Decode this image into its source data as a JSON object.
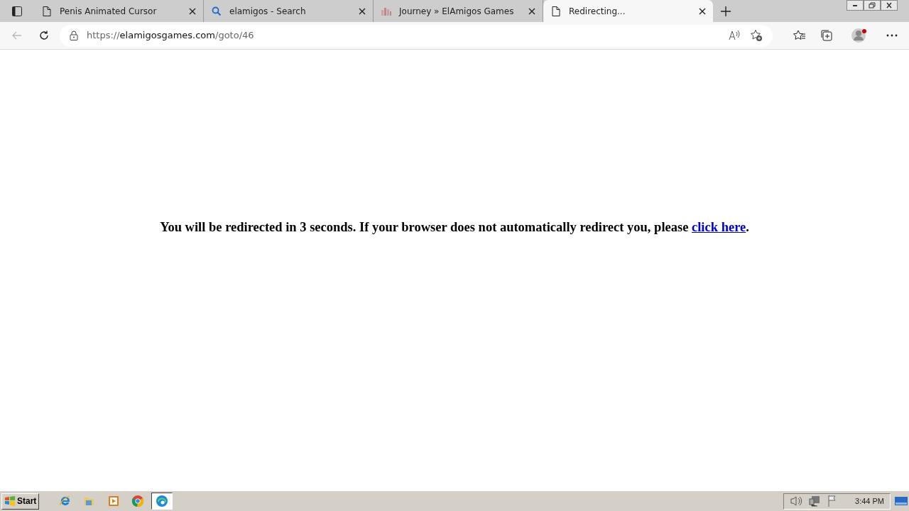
{
  "tabs": [
    {
      "label": "Penis Animated Cursor",
      "kind": "page",
      "selected": false
    },
    {
      "label": "elamigos - Search",
      "kind": "search",
      "selected": false
    },
    {
      "label": "Journey » ElAmigos Games",
      "kind": "site",
      "selected": false
    },
    {
      "label": "Redirecting...",
      "kind": "page",
      "selected": true
    }
  ],
  "address": {
    "scheme": "https://",
    "host": "elamigosgames.com",
    "path": "/goto/46"
  },
  "message": {
    "text": "You will be redirected in 3 seconds. If your browser does not automatically redirect you, please ",
    "link": "click here",
    "end": "."
  },
  "taskbar": {
    "start": "Start",
    "apps": [
      {
        "kind": "ie",
        "selected": false
      },
      {
        "kind": "folder",
        "selected": false
      },
      {
        "kind": "media",
        "selected": false
      },
      {
        "kind": "chrome",
        "selected": false
      },
      {
        "kind": "edge",
        "selected": true
      }
    ],
    "clock": "3:44 PM"
  }
}
